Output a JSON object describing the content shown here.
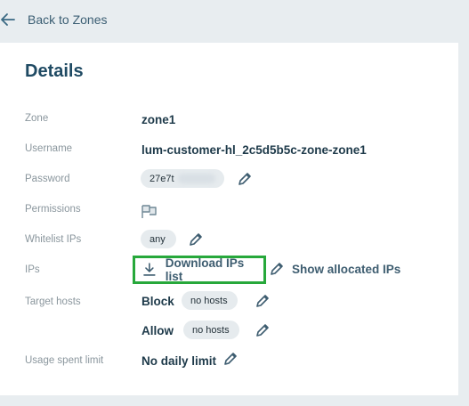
{
  "nav": {
    "back_label": "Back to Zones"
  },
  "details": {
    "title": "Details",
    "zone": {
      "label": "Zone",
      "value": "zone1"
    },
    "username": {
      "label": "Username",
      "value": "lum-customer-hl_2c5d5b5c-zone-zone1"
    },
    "password": {
      "label": "Password",
      "value_visible": "27e7t"
    },
    "permissions": {
      "label": "Permissions",
      "icon": "flag-permissions-icon"
    },
    "whitelist": {
      "label": "Whitelist IPs",
      "value": "any"
    },
    "ips": {
      "label": "IPs",
      "download_label": "Download IPs list",
      "show_allocated_label": "Show allocated IPs"
    },
    "target_hosts": {
      "label": "Target hosts",
      "block_label": "Block",
      "block_value": "no hosts",
      "allow_label": "Allow",
      "allow_value": "no hosts"
    },
    "usage": {
      "label": "Usage spent limit",
      "value": "No daily limit"
    }
  },
  "colors": {
    "highlight": "#27a83b",
    "title": "#1f4a63",
    "background": "#e8edf0"
  }
}
